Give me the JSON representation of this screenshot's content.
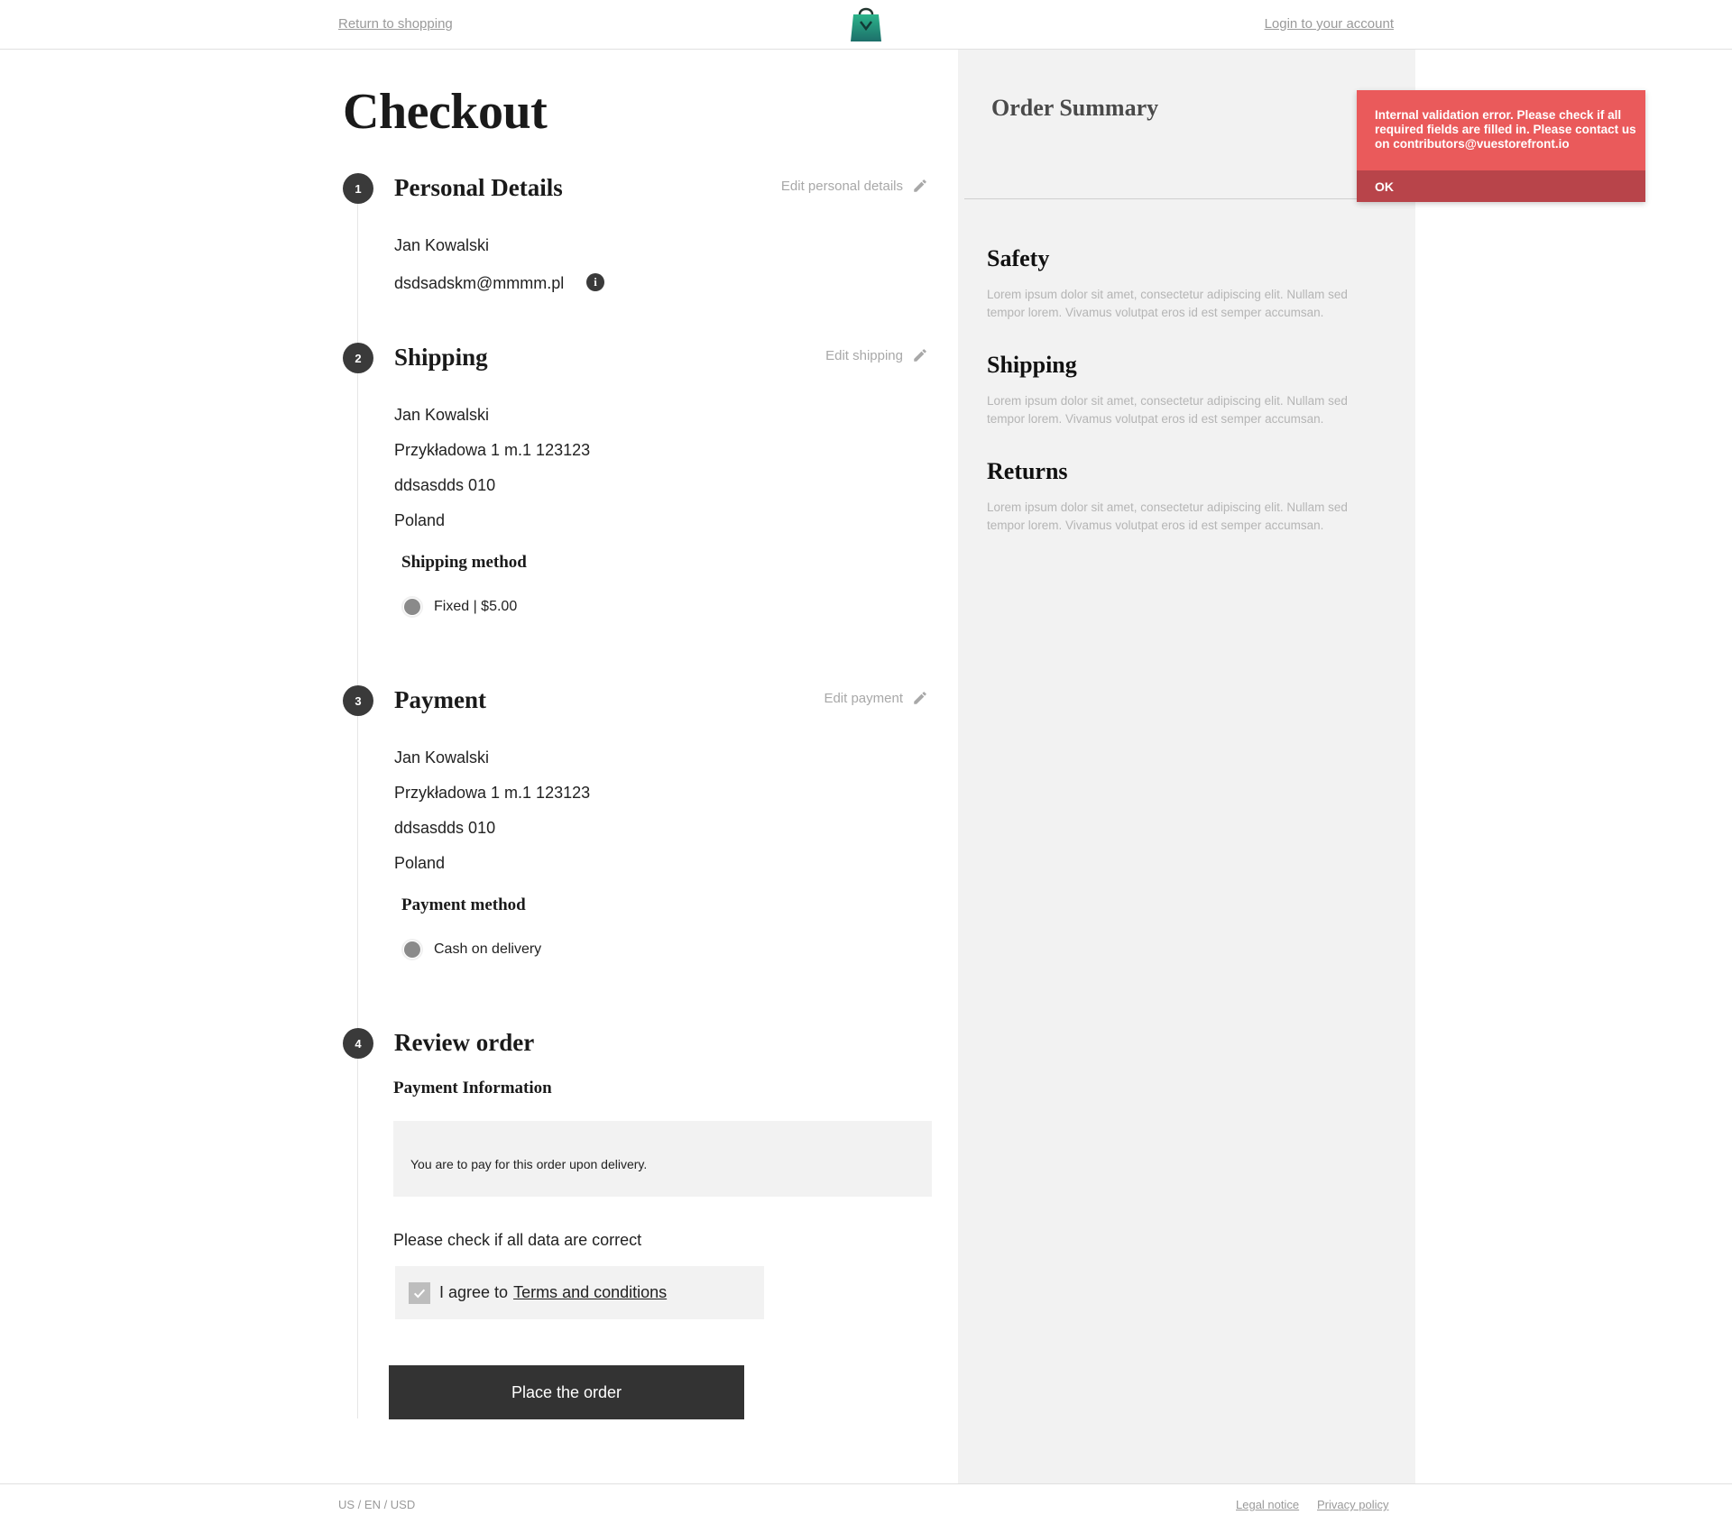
{
  "header": {
    "return_label": "Return to shopping",
    "login_label": "Login to your account",
    "logo_icon": "shopping-bag-logo-icon"
  },
  "checkout": {
    "title": "Checkout",
    "steps": [
      {
        "number": "1",
        "title": "Personal Details",
        "edit_label": "Edit personal details"
      },
      {
        "number": "2",
        "title": "Shipping",
        "edit_label": "Edit shipping"
      },
      {
        "number": "3",
        "title": "Payment",
        "edit_label": "Edit payment"
      },
      {
        "number": "4",
        "title": "Review order"
      }
    ],
    "personal": {
      "name": "Jan Kowalski",
      "email": "dsdsadskm@mmmm.pl",
      "info_icon": "info-icon"
    },
    "shipping": {
      "name": "Jan Kowalski",
      "street": "Przykładowa 1 m.1 123123",
      "city": "ddsasdds 010",
      "country": "Poland",
      "method_title": "Shipping method",
      "method_option": "Fixed | $5.00"
    },
    "payment": {
      "name": "Jan Kowalski",
      "street": "Przykładowa 1 m.1 123123",
      "city": "ddsasdds 010",
      "country": "Poland",
      "method_title": "Payment method",
      "method_option": "Cash on delivery"
    },
    "review": {
      "payment_info_title": "Payment Information",
      "payment_info_text": "You are to pay for this order upon delivery.",
      "check_note": "Please check if all data are correct",
      "agree_prefix": "I agree to",
      "terms_link": "Terms and conditions",
      "terms_checked": true,
      "place_order_label": "Place the order"
    }
  },
  "summary": {
    "title": "Order Summary",
    "sections": [
      {
        "title": "Safety",
        "text": "Lorem ipsum dolor sit amet, consectetur adipiscing elit. Nullam sed tempor lorem. Vivamus volutpat eros id est semper accumsan."
      },
      {
        "title": "Shipping",
        "text": "Lorem ipsum dolor sit amet, consectetur adipiscing elit. Nullam sed tempor lorem. Vivamus volutpat eros id est semper accumsan."
      },
      {
        "title": "Returns",
        "text": "Lorem ipsum dolor sit amet, consectetur adipiscing elit. Nullam sed tempor lorem. Vivamus volutpat eros id est semper accumsan."
      }
    ]
  },
  "toast": {
    "message": "Internal validation error. Please check if all required fields are filled in. Please contact us on contributors@vuestorefront.io",
    "action_label": "OK",
    "color": "#ea5a5b"
  },
  "footer": {
    "locale": "US / EN / USD",
    "legal_label": "Legal notice",
    "privacy_label": "Privacy policy"
  }
}
